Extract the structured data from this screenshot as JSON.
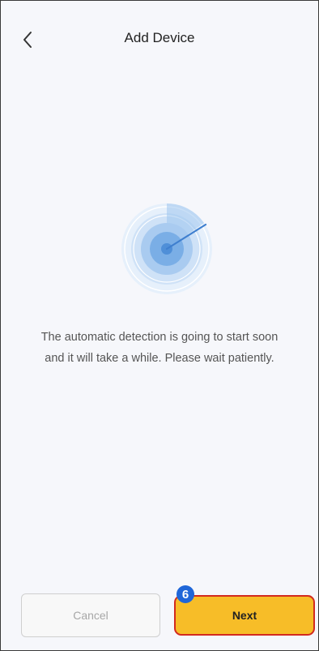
{
  "header": {
    "back_icon": "chevron-left-icon",
    "title": "Add Device"
  },
  "scan": {
    "icon": "radar-icon",
    "message": "The automatic detection is going to start soon and it will take a while. Please wait patiently."
  },
  "footer": {
    "cancel_label": "Cancel",
    "next_label": "Next",
    "step_badge": "6"
  },
  "colors": {
    "background": "#f6f7fb",
    "radar_blue": "#4f8fd8",
    "next_button": "#f7bd28",
    "next_border": "#d22a1f",
    "badge": "#1f66d8"
  }
}
